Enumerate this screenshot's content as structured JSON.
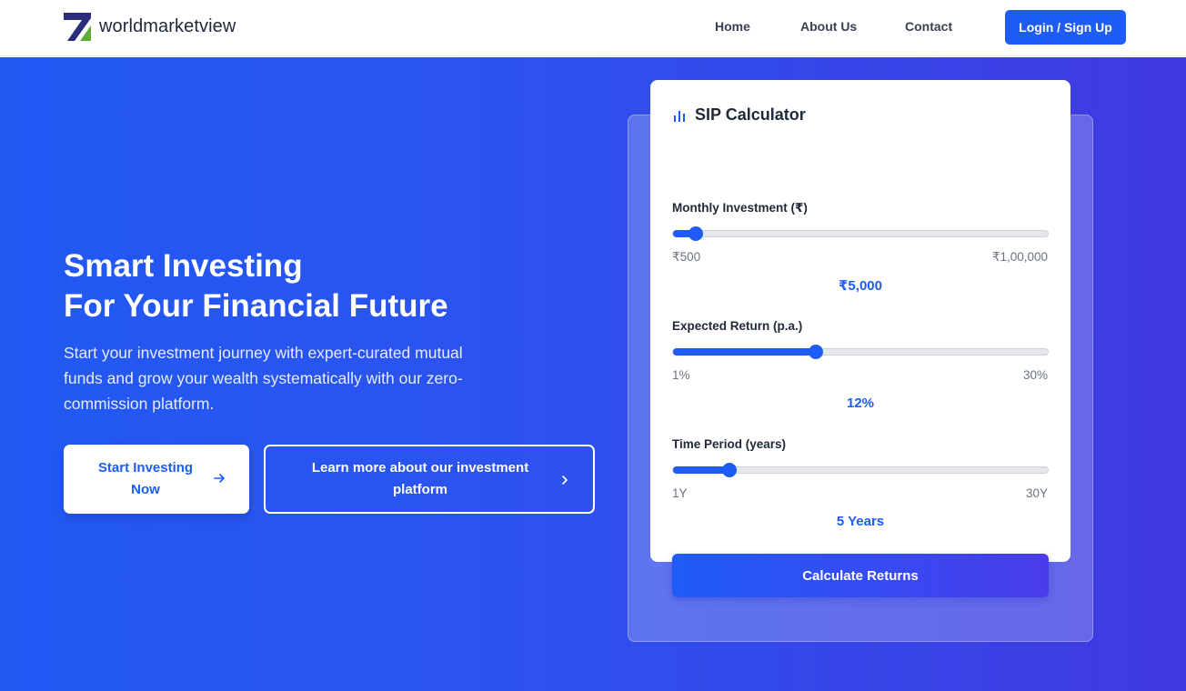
{
  "header": {
    "brand": "worldmarketview",
    "nav": [
      "Home",
      "About Us",
      "Contact"
    ],
    "login_label": "Login / Sign Up"
  },
  "hero": {
    "title_line1": "Smart Investing",
    "title_line2": "For Your Financial Future",
    "description": "Start your investment journey with expert-curated mutual funds and grow your wealth systematically with our zero-commission platform.",
    "primary_cta": "Start Investing Now",
    "secondary_cta": "Learn more about our investment platform"
  },
  "calculator": {
    "title": "SIP Calculator",
    "icon": "bar-chart-icon",
    "fields": [
      {
        "label": "Monthly Investment (₹)",
        "min": "₹500",
        "max": "₹1,00,000",
        "value": "₹5,000",
        "fill_fraction": 0.06
      },
      {
        "label": "Expected Return (p.a.)",
        "min": "1%",
        "max": "30%",
        "value": "12%",
        "fill_fraction": 0.38
      },
      {
        "label": "Time Period (years)",
        "min": "1Y",
        "max": "30Y",
        "value": "5 Years",
        "fill_fraction": 0.15
      }
    ],
    "button_label": "Calculate Returns"
  },
  "colors": {
    "accent": "#1d5cf5",
    "hero_start": "#2159f3",
    "hero_end": "#4039e1",
    "logo_dark": "#2a2d7c",
    "logo_green": "#5fae3b"
  }
}
